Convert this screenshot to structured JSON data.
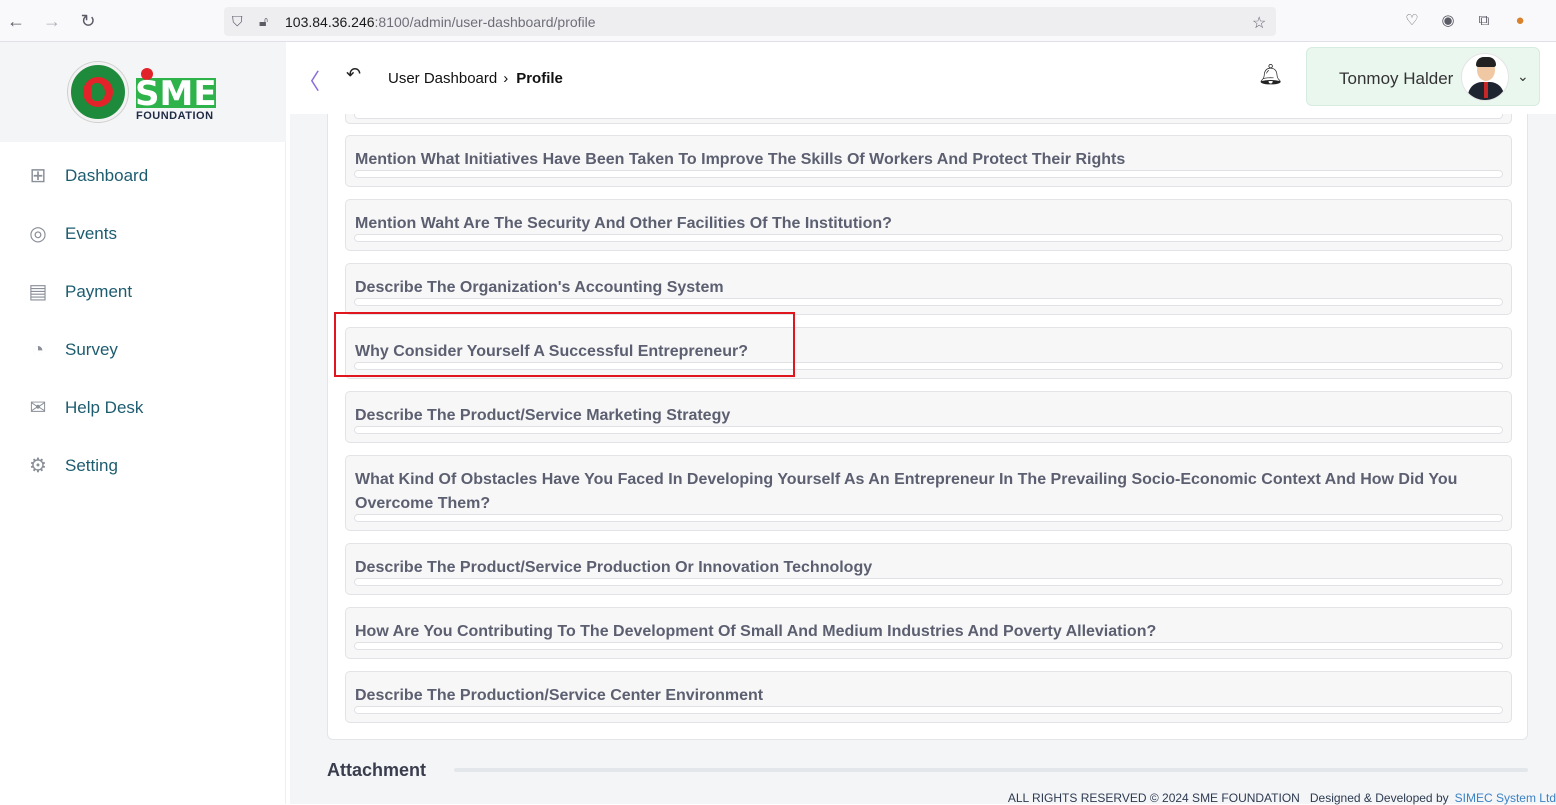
{
  "browser": {
    "url_host": "103.84.36.246",
    "url_rest": ":8100/admin/user-dashboard/profile"
  },
  "logo": {
    "sme": "SME",
    "foundation": "FOUNDATION"
  },
  "sidebar": {
    "items": [
      {
        "label": "Dashboard",
        "icon": "grid-icon"
      },
      {
        "label": "Events",
        "icon": "events-icon"
      },
      {
        "label": "Payment",
        "icon": "payment-icon"
      },
      {
        "label": "Survey",
        "icon": "pie-chart-icon"
      },
      {
        "label": "Help Desk",
        "icon": "mail-icon"
      },
      {
        "label": "Setting",
        "icon": "gear-icon"
      }
    ]
  },
  "header": {
    "breadcrumb_parent": "User Dashboard",
    "breadcrumb_current": "Profile",
    "user_name": "Tonmoy Halder"
  },
  "questions": [
    {
      "text": "Mention What Initiatives Have Been Taken To Improve The Skills Of Workers And Protect Their Rights"
    },
    {
      "text": "Mention Waht Are The Security And Other Facilities Of The Institution?"
    },
    {
      "text": "Describe The Organization's Accounting System"
    },
    {
      "text": "Why Consider Yourself A Successful Entrepreneur?"
    },
    {
      "text": "Describe The Product/Service Marketing Strategy"
    },
    {
      "text": "What Kind Of Obstacles Have You Faced In Developing Yourself As An Entrepreneur In The Prevailing Socio-Economic Context And How Did You Overcome Them?"
    },
    {
      "text": "Describe The Product/Service Production Or Innovation Technology"
    },
    {
      "text": "How Are You Contributing To The Development Of Small And Medium Industries And Poverty Alleviation?"
    },
    {
      "text": "Describe The Production/Service Center Environment"
    }
  ],
  "attachment": {
    "title": "Attachment"
  },
  "footer": {
    "rights": "ALL RIGHTS RESERVED © 2024 SME FOUNDATION",
    "designed": "Designed & Developed by",
    "company": "SIMEC System Ltd"
  },
  "colors": {
    "accent_green": "#2db34a",
    "sidebar_text": "#1d5c6f",
    "highlight_red": "#e0161e"
  }
}
